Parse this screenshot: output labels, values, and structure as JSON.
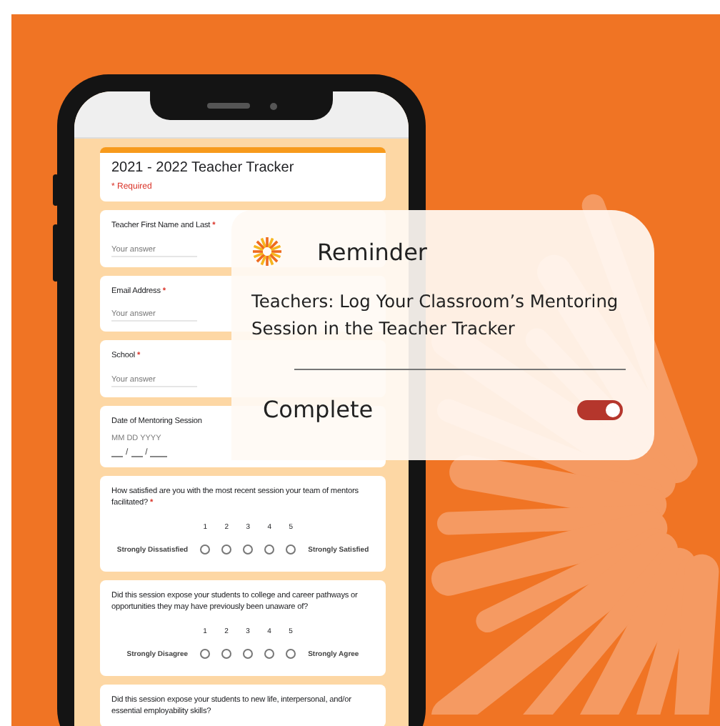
{
  "form": {
    "title": "2021 - 2022 Teacher Tracker",
    "required_note": "* Required",
    "questions": [
      {
        "kind": "text",
        "label": "Teacher First Name and Last",
        "required_mark": "*",
        "placeholder": "Your answer"
      },
      {
        "kind": "text",
        "label": "Email Address",
        "required_mark": "*",
        "placeholder": "Your answer"
      },
      {
        "kind": "text",
        "label": "School",
        "required_mark": "*",
        "placeholder": "Your answer"
      },
      {
        "kind": "date",
        "label": "Date of Mentoring Session",
        "format": "MM DD  YYYY",
        "separators": [
          "/",
          "/"
        ]
      },
      {
        "kind": "scale",
        "label": "How satisfied are you with the most recent session your team of mentors facilitated?",
        "required_mark": "*",
        "low_label": "Strongly Dissatisfied",
        "high_label": "Strongly Satisfied",
        "options": [
          {
            "label": "1",
            "selected": false
          },
          {
            "label": "2",
            "selected": false
          },
          {
            "label": "3",
            "selected": false
          },
          {
            "label": "4",
            "selected": false
          },
          {
            "label": "5",
            "selected": false
          }
        ]
      },
      {
        "kind": "scale",
        "label": "Did this session expose your students to college and career pathways or opportunities they may have previously been unaware of?",
        "low_label": "Strongly Disagree",
        "high_label": "Strongly Agree",
        "options": [
          {
            "label": "1",
            "selected": false
          },
          {
            "label": "2",
            "selected": false
          },
          {
            "label": "3",
            "selected": false
          },
          {
            "label": "4",
            "selected": false
          },
          {
            "label": "5",
            "selected": false
          }
        ]
      },
      {
        "kind": "heading",
        "label": "Did this session expose your students to new life, interpersonal, and/or essential employability skills?"
      }
    ]
  },
  "reminder": {
    "title": "Reminder",
    "message": "Teachers: Log Your Classroom’s Mentoring Session in the Teacher Tracker",
    "complete_label": "Complete",
    "complete_on": true
  }
}
